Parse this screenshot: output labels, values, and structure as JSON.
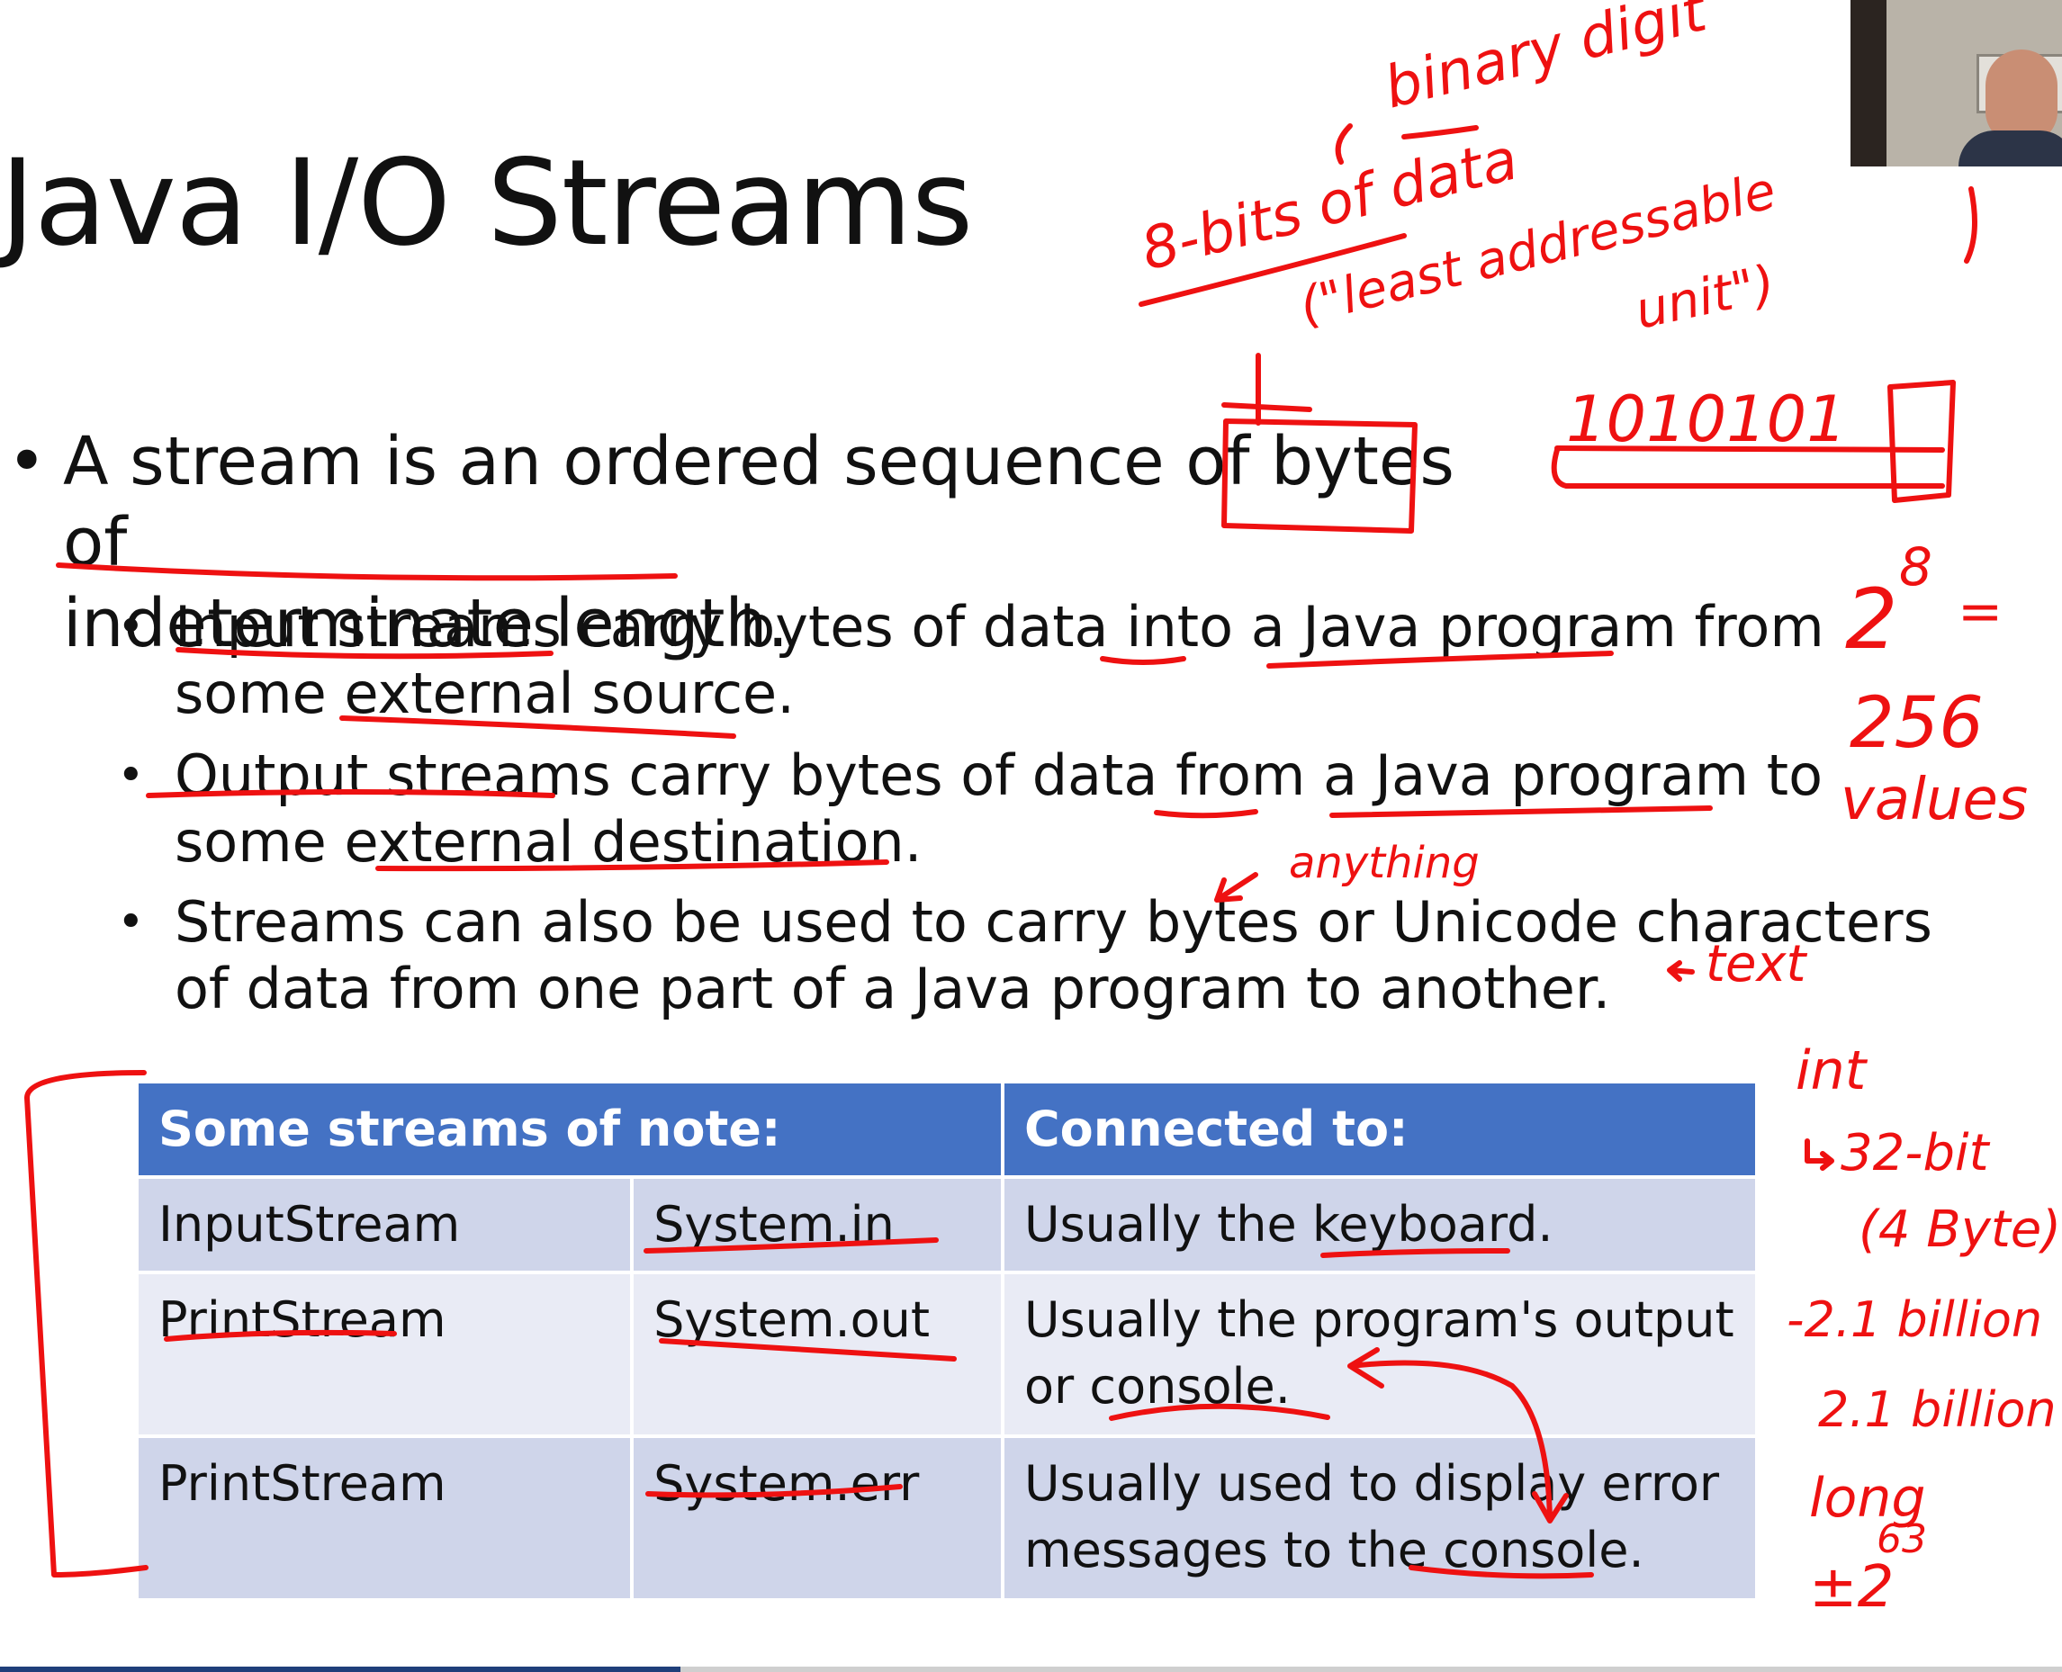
{
  "slide": {
    "title": "Java I/O Streams",
    "bullet_main_line1": "A stream is an ordered sequence of bytes of",
    "bullet_main_line2": "indeterminate length.",
    "sub_bullets": [
      {
        "line1": "Input streams carry bytes of data into a Java program from",
        "line2": "some external source."
      },
      {
        "line1": "Output streams carry bytes of data from a Java program to",
        "line2": "some external destination."
      },
      {
        "line1": "Streams can also be used to carry bytes or Unicode characters",
        "line2": "of data from one part of a Java program to another."
      }
    ],
    "bullet_glyph": "•"
  },
  "table": {
    "header_col1": "Some streams of note:",
    "header_col2": "Connected to:",
    "rows": [
      {
        "class": "InputStream",
        "object": "System.in",
        "target_line1": "Usually the keyboard.",
        "target_line2": ""
      },
      {
        "class": "PrintStream",
        "object": "System.out",
        "target_line1": "Usually the program's output",
        "target_line2": "or console."
      },
      {
        "class": "PrintStream",
        "object": "System.err",
        "target_line1": "Usually used to display error",
        "target_line2": "messages to the console."
      }
    ],
    "header_color": "#4472c4",
    "row_dark": "#cfd5ea",
    "row_light": "#e9ebf5"
  },
  "annotations": {
    "binary": "binary digit",
    "bits": "8-bits of data",
    "least": "(\"least addressable",
    "unit": "unit\")",
    "bit_pattern": "1010101",
    "pow_base": "2",
    "pow_exp": "8",
    "equals": "=",
    "count": "256",
    "values": "values",
    "anything": "anything",
    "text": "text",
    "int": "int",
    "int_size": "32-bit",
    "int_bytes": "(4 Byte)",
    "neg": "-2.1 billion",
    "pos": "2.1 billion",
    "long": "long",
    "long_range": "±2",
    "long_exp": "63",
    "ink_color": "#ee1111"
  },
  "webcam": {
    "icon": "presenter-webcam"
  },
  "progress": {
    "fraction": 0.33
  }
}
